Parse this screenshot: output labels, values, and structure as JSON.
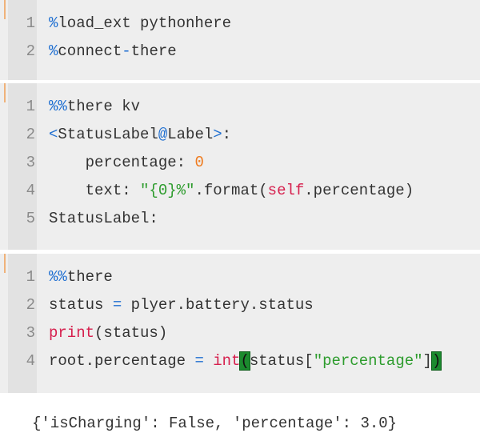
{
  "cells": [
    {
      "lines": [
        {
          "n": "1",
          "tokens": [
            {
              "t": "%",
              "c": "kw-blue"
            },
            {
              "t": "load_ext pythonhere",
              "c": ""
            }
          ]
        },
        {
          "n": "2",
          "tokens": [
            {
              "t": "%",
              "c": "kw-blue"
            },
            {
              "t": "connect",
              "c": ""
            },
            {
              "t": "-",
              "c": "op"
            },
            {
              "t": "there",
              "c": ""
            }
          ]
        }
      ]
    },
    {
      "lines": [
        {
          "n": "1",
          "tokens": [
            {
              "t": "%%",
              "c": "kw-blue"
            },
            {
              "t": "there kv",
              "c": ""
            }
          ]
        },
        {
          "n": "2",
          "tokens": [
            {
              "t": "<",
              "c": "op"
            },
            {
              "t": "StatusLabel",
              "c": ""
            },
            {
              "t": "@",
              "c": "op"
            },
            {
              "t": "Label",
              "c": ""
            },
            {
              "t": ">",
              "c": "op"
            },
            {
              "t": ":",
              "c": ""
            }
          ]
        },
        {
          "n": "3",
          "tokens": [
            {
              "t": "    percentage: ",
              "c": ""
            },
            {
              "t": "0",
              "c": "num"
            }
          ]
        },
        {
          "n": "4",
          "tokens": [
            {
              "t": "    text: ",
              "c": ""
            },
            {
              "t": "\"{0}%\"",
              "c": "str"
            },
            {
              "t": ".format(",
              "c": ""
            },
            {
              "t": "self",
              "c": "kw-red"
            },
            {
              "t": ".percentage)",
              "c": ""
            }
          ]
        },
        {
          "n": "5",
          "tokens": [
            {
              "t": "StatusLabel:",
              "c": ""
            }
          ]
        }
      ]
    },
    {
      "lines": [
        {
          "n": "1",
          "tokens": [
            {
              "t": "%%",
              "c": "kw-blue"
            },
            {
              "t": "there",
              "c": ""
            }
          ]
        },
        {
          "n": "2",
          "tokens": [
            {
              "t": "status ",
              "c": ""
            },
            {
              "t": "=",
              "c": "op"
            },
            {
              "t": " plyer.battery.status",
              "c": ""
            }
          ]
        },
        {
          "n": "3",
          "tokens": [
            {
              "t": "print",
              "c": "kw-red"
            },
            {
              "t": "(status)",
              "c": ""
            }
          ]
        },
        {
          "n": "4",
          "tokens": [
            {
              "t": "root.percentage ",
              "c": ""
            },
            {
              "t": "=",
              "c": "op"
            },
            {
              "t": " ",
              "c": ""
            },
            {
              "t": "int",
              "c": "kw-red"
            },
            {
              "t": "(",
              "c": "bracket-hl"
            },
            {
              "t": "status[",
              "c": ""
            },
            {
              "t": "\"percentage\"",
              "c": "str"
            },
            {
              "t": "]",
              "c": ""
            },
            {
              "t": ")",
              "c": "bracket-hl"
            }
          ]
        }
      ]
    }
  ],
  "output": "{'isCharging': False, 'percentage': 3.0}",
  "colors": {
    "cell_bg": "#eeeeee",
    "gutter_bg": "#e2e2e2",
    "accent": "#f0b27a",
    "keyword_blue": "#1f6fd1",
    "keyword_red": "#d6204e",
    "string_green": "#2d9c2d",
    "number_orange": "#ef7b1f",
    "bracket_highlight": "#1b8a2e"
  }
}
